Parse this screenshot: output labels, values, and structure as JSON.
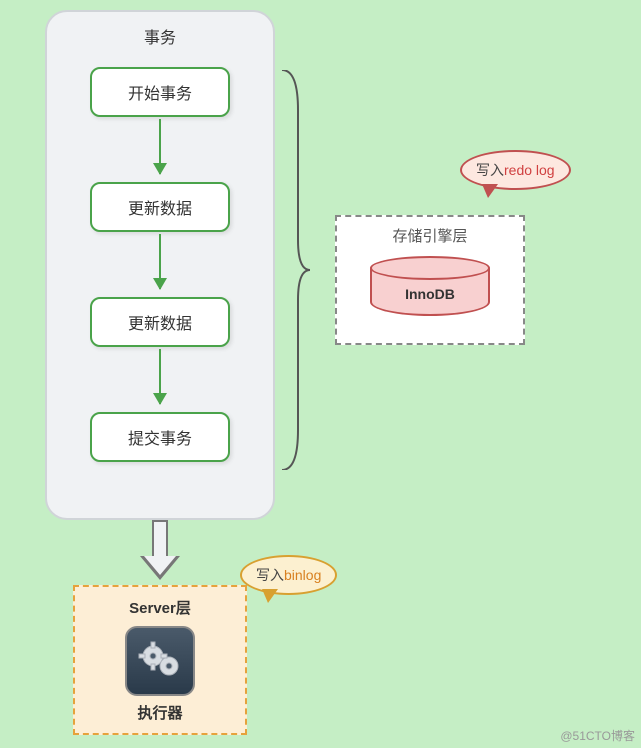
{
  "transaction": {
    "title": "事务",
    "steps": [
      "开始事务",
      "更新数据",
      "更新数据",
      "提交事务"
    ]
  },
  "storage": {
    "title": "存储引擎层",
    "engine": "InnoDB"
  },
  "server": {
    "title": "Server层",
    "sub": "执行器"
  },
  "bubbles": {
    "redo_prefix": "写入",
    "redo_log": "redo log",
    "binlog_prefix": "写入",
    "binlog": "binlog"
  },
  "watermark": "@51CTO博客",
  "chart_data": {
    "type": "diagram",
    "title": "事务",
    "flow": [
      {
        "node": "开始事务"
      },
      {
        "edge": "arrow"
      },
      {
        "node": "更新数据"
      },
      {
        "edge": "arrow"
      },
      {
        "node": "更新数据"
      },
      {
        "edge": "arrow"
      },
      {
        "node": "提交事务"
      }
    ],
    "annotations": [
      {
        "from_range": [
          "开始事务",
          "提交事务"
        ],
        "target": "存储引擎层 InnoDB",
        "label": "写入redo log"
      },
      {
        "from": "提交事务",
        "target": "Server层 执行器",
        "label": "写入binlog"
      }
    ]
  }
}
